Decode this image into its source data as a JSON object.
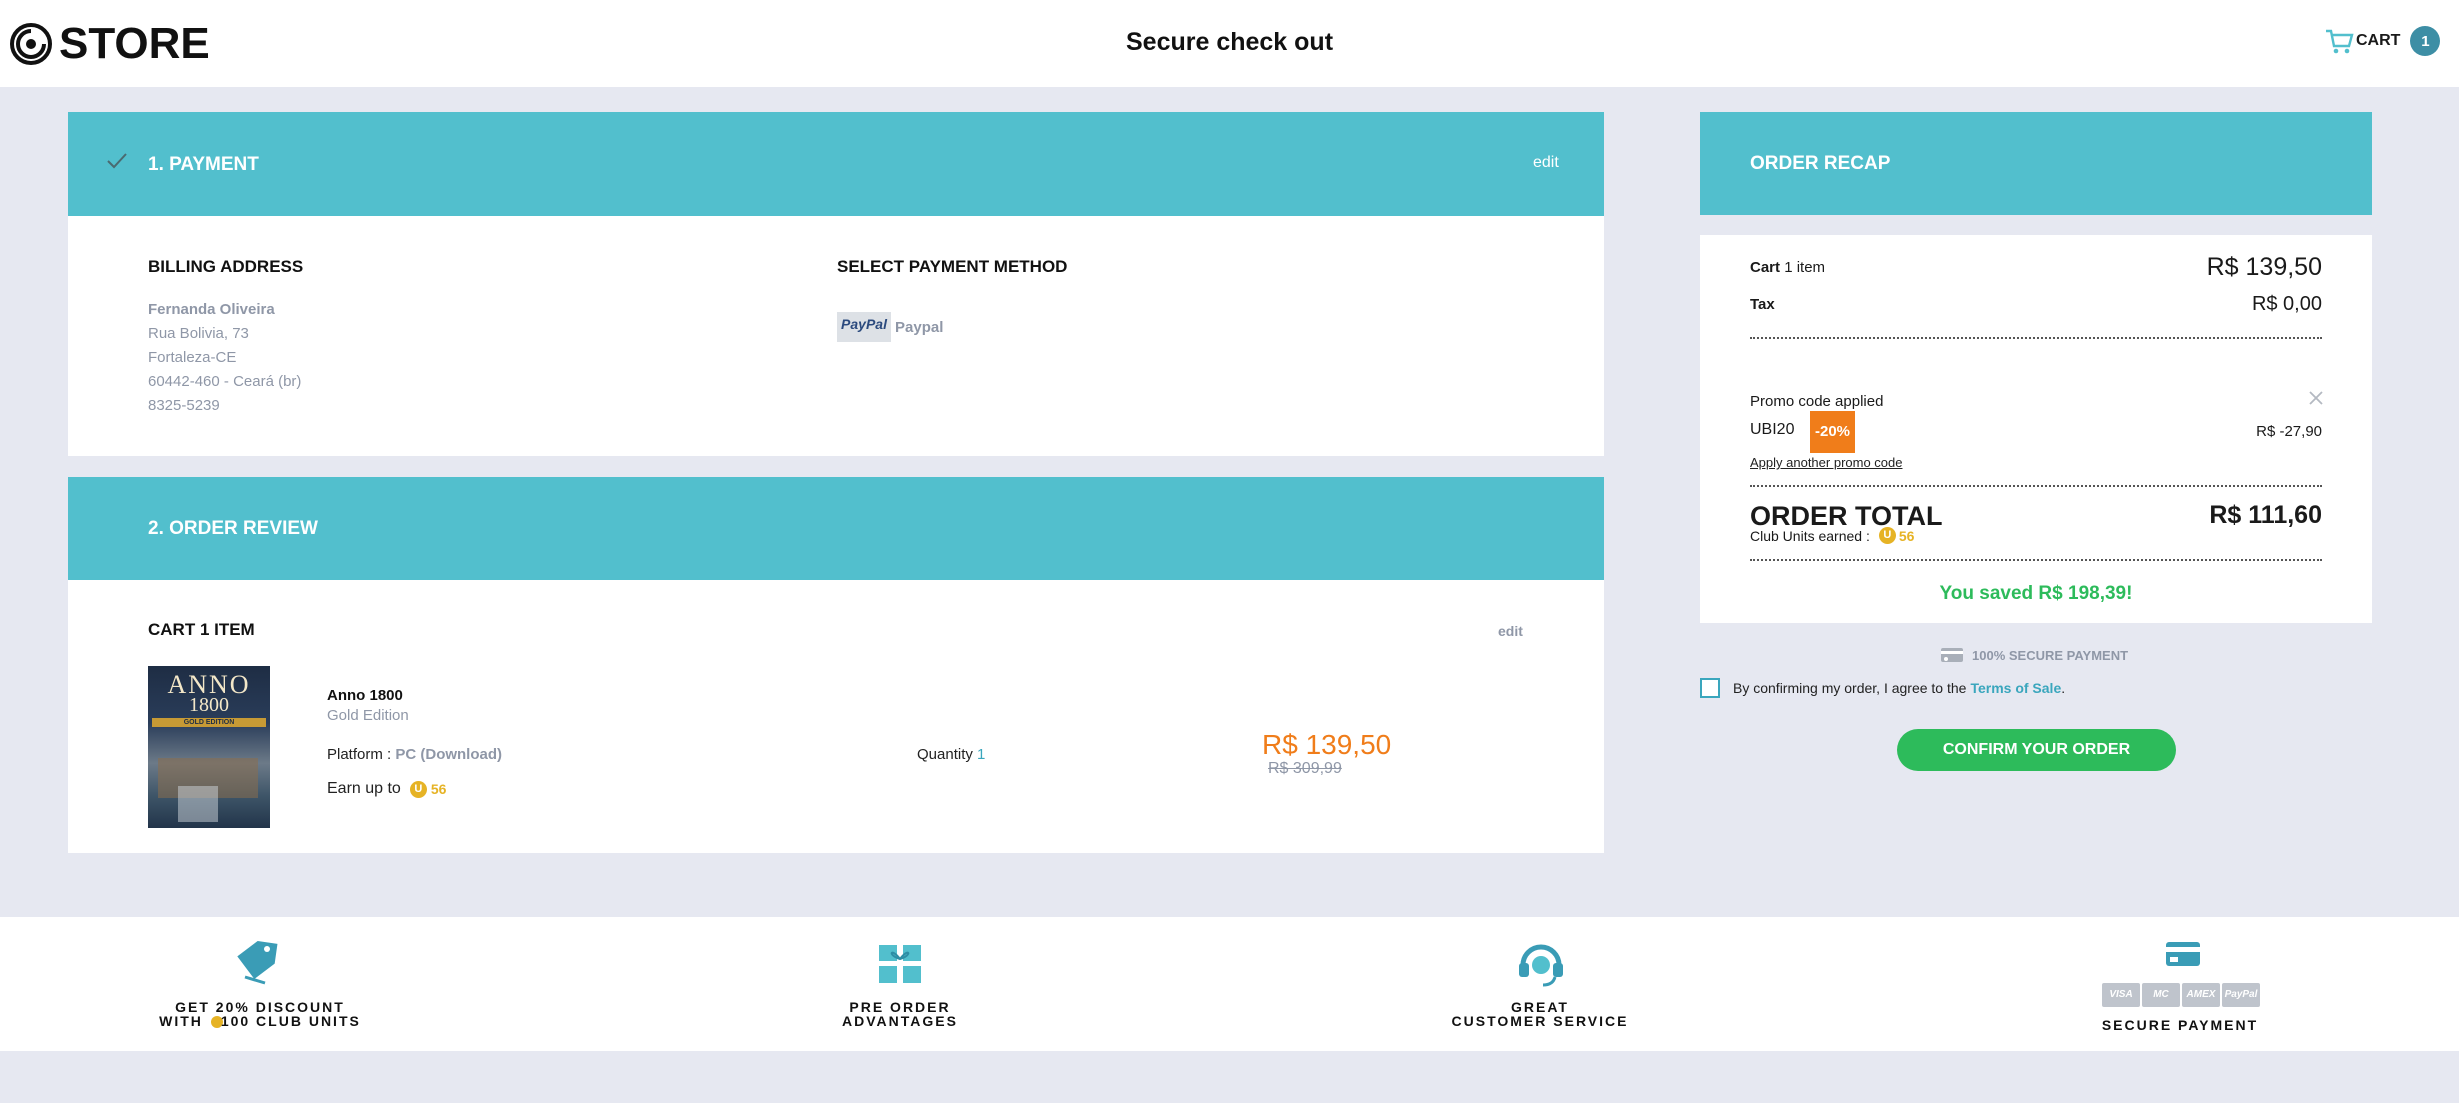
{
  "header": {
    "logo_text": "STORE",
    "title": "Secure check out",
    "cart_label": "CART",
    "cart_count": "1"
  },
  "payment_section": {
    "title": "1. PAYMENT",
    "edit_label": "edit",
    "billing_heading": "BILLING ADDRESS",
    "billing": {
      "name": "Fernanda Oliveira",
      "street": "Rua Bolivia, 73",
      "city": "Fortaleza-CE",
      "zip": "60442-460 - Ceará (br)",
      "phone": "8325-5239"
    },
    "method_heading": "SELECT PAYMENT METHOD",
    "method_logo": "PayPal",
    "method_name": "Paypal"
  },
  "review_section": {
    "title": "2. ORDER REVIEW",
    "cart_heading": "CART 1 ITEM",
    "edit_label": "edit",
    "item": {
      "cover_title": "ANNO",
      "cover_year": "1800",
      "cover_edition": "GOLD EDITION",
      "name": "Anno 1800",
      "edition": "Gold Edition",
      "platform_label": "Platform :",
      "platform_value": "PC (Download)",
      "earn_label": "Earn up to",
      "earn_units": "56",
      "quantity_label": "Quantity",
      "quantity_value": "1",
      "price": "R$ 139,50",
      "old_price": "R$ 309,99"
    }
  },
  "recap": {
    "title": "ORDER RECAP",
    "cart_label": "Cart",
    "cart_items": "1 item",
    "cart_price": "R$ 139,50",
    "tax_label": "Tax",
    "tax_value": "R$ 0,00",
    "promo_applied": "Promo code applied",
    "promo_code": "UBI20",
    "promo_badge": "-20%",
    "promo_discount": "R$ -27,90",
    "apply_another": "Apply another promo code",
    "total_label": "ORDER TOTAL",
    "total_value": "R$ 111,60",
    "club_label": "Club Units earned :",
    "club_units": "56",
    "saved": "You saved R$ 198,39!",
    "secure_label": "100% SECURE PAYMENT",
    "terms_prefix": "By confirming my order, I agree to the",
    "terms_link": "Terms of Sale",
    "terms_suffix": ".",
    "confirm_label": "CONFIRM YOUR ORDER"
  },
  "footer": {
    "features": [
      {
        "line1": "GET 20% DISCOUNT",
        "line2_prefix": "WITH",
        "line2_suffix": "100 CLUB UNITS"
      },
      {
        "line1": "PRE ORDER",
        "line2": "ADVANTAGES"
      },
      {
        "line1": "GREAT",
        "line2": "CUSTOMER SERVICE"
      },
      {
        "line1": "SECURE PAYMENT"
      }
    ],
    "cards": [
      "VISA",
      "MC",
      "AMEX",
      "PayPal"
    ]
  },
  "colors": {
    "teal": "#52bfcd",
    "orange_price": "#f07d1a",
    "green": "#2dbb5b",
    "club_gold": "#e6b325",
    "link_teal": "#3aa6bd"
  }
}
